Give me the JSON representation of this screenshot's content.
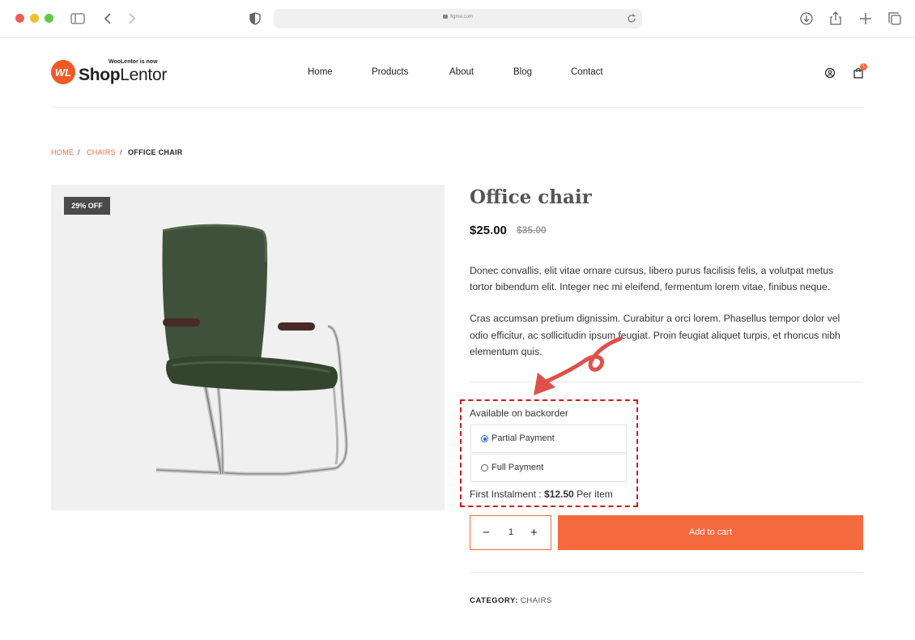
{
  "browser": {
    "url": "figma.com",
    "icons": [
      "sidebar-icon",
      "back-icon",
      "forward-icon",
      "shield-icon",
      "lock-icon",
      "reload-icon",
      "download-icon",
      "share-icon",
      "new-tab-icon",
      "tabs-icon"
    ]
  },
  "header": {
    "logo_tagline": "WooLentor is now",
    "logo_bold": "Shop",
    "logo_rest": "Lentor",
    "nav": [
      "Home",
      "Products",
      "About",
      "Blog",
      "Contact"
    ],
    "cart_count": "1"
  },
  "breadcrumb": {
    "home": "HOME",
    "category": "CHAIRS",
    "current": "OFFICE CHAIR",
    "sep": "/"
  },
  "product": {
    "badge": "29% OFF",
    "title": "Office chair",
    "price": "$25.00",
    "old_price": "$35.00",
    "desc1_line1": "Donec convallis, elit vitae ornare cursus, libero purus facilisis felis, a volutpat metus",
    "desc1_line2": "tortor bibendum elit. Integer nec mi eleifend, fermentum lorem vitae, finibus neque.",
    "desc2_line1": "Cras accumsan pretium dignissim. Curabitur a orci lorem. Phasellus tempor dolor vel",
    "desc2_line2": "odio efficitur, ac sollicitudin ipsum feugiat. Proin feugiat aliquet turpis, et rhoncus nibh",
    "desc2_line3": "elementum quis.",
    "availability": "Available on backorder",
    "payment_options": [
      "Partial Payment",
      "Full Payment"
    ],
    "selected_payment": "Partial Payment",
    "instalment_label": "First Instalment :",
    "instalment_amount": "$12.50",
    "instalment_suffix": "Per item",
    "quantity": "1",
    "add_to_cart": "Add to cart",
    "category_label": "CATEGORY:",
    "category_value": "CHAIRS"
  },
  "colors": {
    "accent": "#f4693d",
    "highlight_box": "#d21919",
    "chair_green": "#3c4e36"
  }
}
